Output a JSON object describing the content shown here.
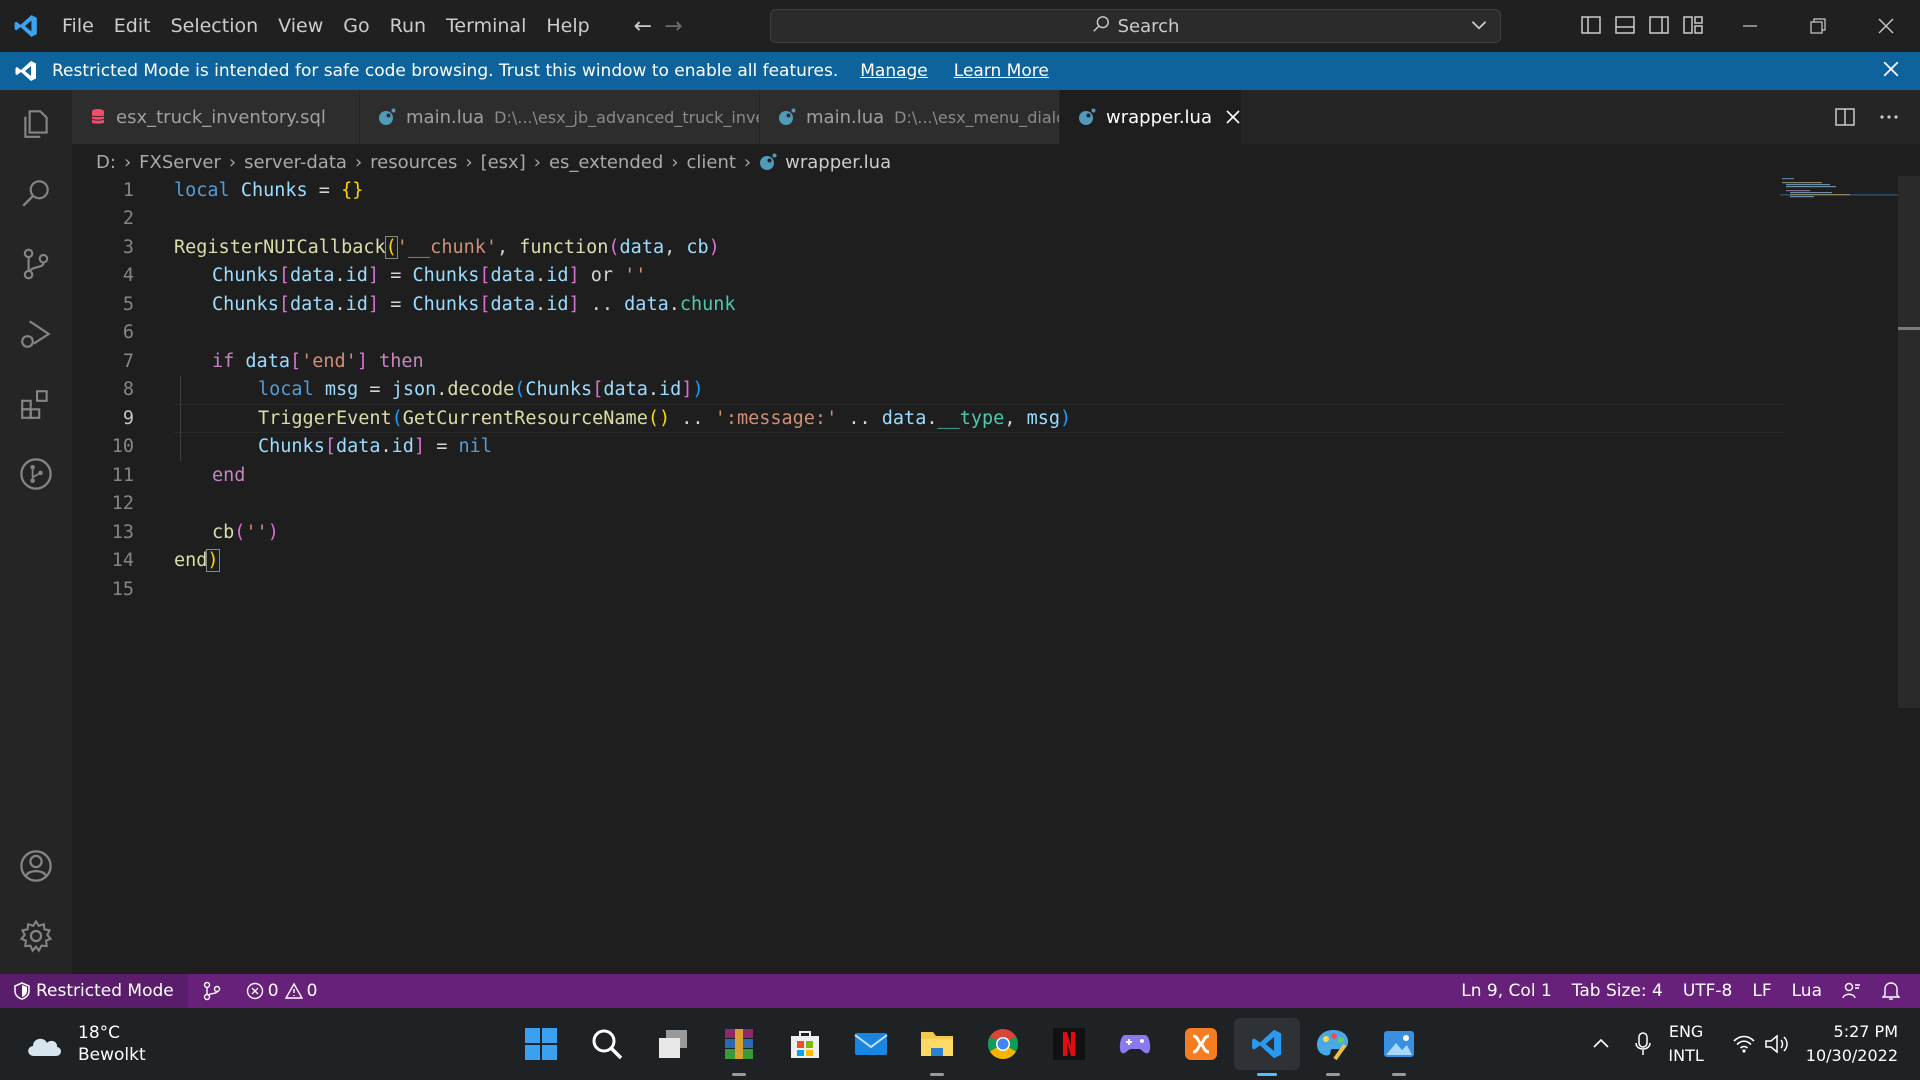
{
  "menu": [
    "File",
    "Edit",
    "Selection",
    "View",
    "Go",
    "Run",
    "Terminal",
    "Help"
  ],
  "search": {
    "label": "Search"
  },
  "banner": {
    "text": "Restricted Mode is intended for safe code browsing. Trust this window to enable all features.",
    "manage": "Manage",
    "learn_more": "Learn More"
  },
  "tabs": [
    {
      "name": "esx_truck_inventory.sql",
      "path": "",
      "icon": "database-icon"
    },
    {
      "name": "main.lua",
      "path": "D:\\...\\esx_jb_advanced_truck_inventory\\...",
      "icon": "lua-icon"
    },
    {
      "name": "main.lua",
      "path": "D:\\...\\esx_menu_dialog\\...",
      "icon": "lua-icon"
    },
    {
      "name": "wrapper.lua",
      "path": "",
      "icon": "lua-icon",
      "active": true
    }
  ],
  "breadcrumb": [
    "D:",
    "FXServer",
    "server-data",
    "resources",
    "[esx]",
    "es_extended",
    "client",
    "wrapper.lua"
  ],
  "line_numbers": [
    "1",
    "2",
    "3",
    "4",
    "5",
    "6",
    "7",
    "8",
    "9",
    "10",
    "11",
    "12",
    "13",
    "14",
    "15"
  ],
  "current_line": 9,
  "code": {
    "l1": {
      "a": "local",
      "b": "Chunks",
      "c": " = ",
      "d": "{}"
    },
    "l3": {
      "a": "RegisterNUICallback",
      "b": "(",
      "c": "'__chunk'",
      "d": ", ",
      "e": "function",
      "f": "(",
      "g": "data",
      "h": ", ",
      "i": "cb",
      "j": ")"
    },
    "l4": {
      "a": "Chunks",
      "b": "[",
      "c": "data",
      "d": ".",
      "e": "id",
      "f": "]",
      "g": " = ",
      "h": "Chunks",
      "i": "[",
      "j": "data",
      "k": ".",
      "l": "id",
      "m": "]",
      "n": " or ",
      "o": "''"
    },
    "l5": {
      "a": "Chunks",
      "b": "[",
      "c": "data",
      "d": ".",
      "e": "id",
      "f": "]",
      "g": " = ",
      "h": "Chunks",
      "i": "[",
      "j": "data",
      "k": ".",
      "l": "id",
      "m": "]",
      "n": " .. ",
      "o": "data",
      "p": ".",
      "q": "chunk"
    },
    "l7": {
      "a": "if",
      "b": " data",
      "c": "[",
      "d": "'end'",
      "e": "]",
      "f": " then"
    },
    "l8": {
      "a": "local",
      "b": " msg",
      "c": " = ",
      "d": "json",
      "e": ".",
      "f": "decode",
      "g": "(",
      "h": "Chunks",
      "i": "[",
      "j": "data",
      "k": ".",
      "l": "id",
      "m": "]",
      "n": ")"
    },
    "l9": {
      "a": "TriggerEvent",
      "b": "(",
      "c": "GetCurrentResourceName",
      "d": "()",
      "e": " .. ",
      "f": "':message:'",
      "g": " .. ",
      "h": "data",
      "i": ".",
      "j": "__type",
      "k": ", ",
      "l": "msg",
      "m": ")"
    },
    "l10": {
      "a": "Chunks",
      "b": "[",
      "c": "data",
      "d": ".",
      "e": "id",
      "f": "]",
      "g": " = ",
      "h": "nil"
    },
    "l11": {
      "a": "end"
    },
    "l13": {
      "a": "cb",
      "b": "(",
      "c": "''",
      "d": ")"
    },
    "l14": {
      "a": "end",
      "b": ")"
    }
  },
  "status": {
    "restricted": "Restricted Mode",
    "errors": "0",
    "warnings": "0",
    "position": "Ln 9, Col 1",
    "tab_size": "Tab Size: 4",
    "encoding": "UTF-8",
    "eol": "LF",
    "language": "Lua"
  },
  "taskbar": {
    "weather_temp": "18°C",
    "weather_desc": "Bewolkt",
    "lang_top": "ENG",
    "lang_bottom": "INTL",
    "time": "5:27 PM",
    "date": "10/30/2022"
  },
  "colors": {
    "banner": "#0e639c",
    "statusbar": "#68217a",
    "keyword": "#569cd6",
    "variable": "#9cdcfe",
    "function": "#dcdcaa",
    "string": "#ce9178"
  }
}
